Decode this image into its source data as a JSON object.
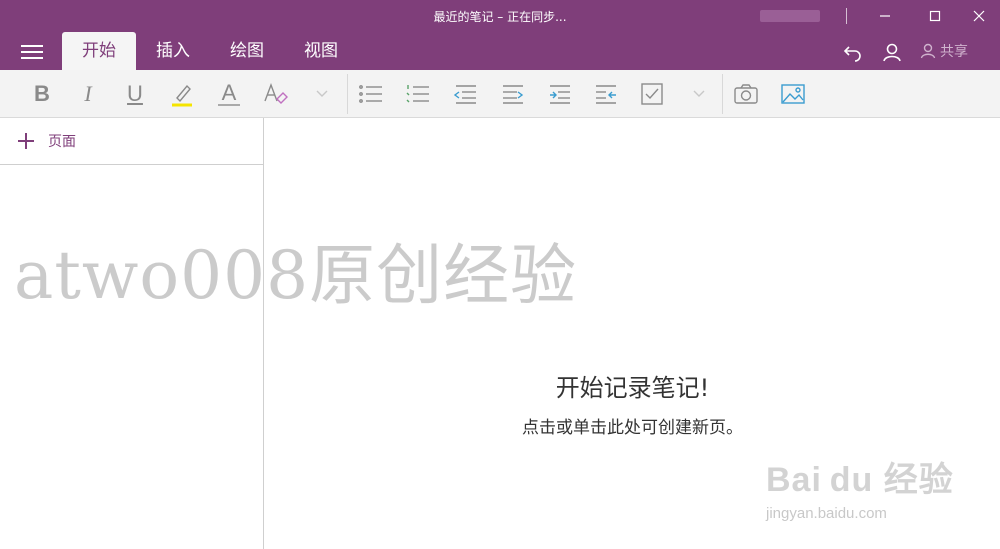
{
  "window": {
    "title": "最近的笔记 – 正在同步..."
  },
  "ribbon": {
    "tabs": [
      {
        "label": "开始",
        "active": true
      },
      {
        "label": "插入",
        "active": false
      },
      {
        "label": "绘图",
        "active": false
      },
      {
        "label": "视图",
        "active": false
      }
    ],
    "share_label": "共享"
  },
  "toolbar": {
    "bold_label": "B",
    "italic_label": "I",
    "underline_label": "U",
    "font_color_label": "A",
    "highlight_color": "#f5e400"
  },
  "sidebar": {
    "add_page_label": "页面"
  },
  "canvas": {
    "title": "开始记录笔记!",
    "subtitle": "点击或单击此处可创建新页。"
  },
  "watermarks": {
    "author": "atwo008原创经验",
    "brand": "Bai du 经验",
    "url": "jingyan.baidu.com"
  },
  "colors": {
    "accent": "#7f3e7a",
    "toolbar_bg": "#f3f3f3"
  }
}
